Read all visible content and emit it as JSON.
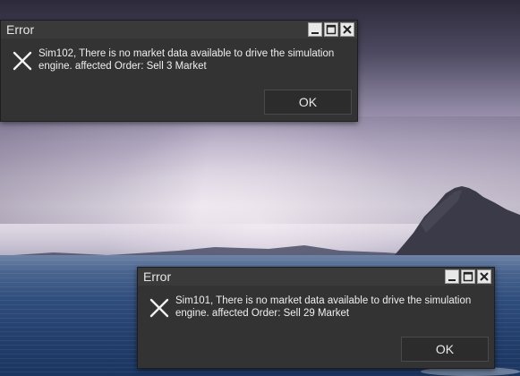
{
  "colors": {
    "dialog_bg": "#333333",
    "titlebar_bg": "#3a3a3a",
    "text": "#efefef",
    "button_bg": "#2c2c2c"
  },
  "dialogs": [
    {
      "title": "Error",
      "icon": "close-x-icon",
      "message": "Sim102, There is no market data available to drive the simulation engine. affected Order: Sell 3 Market",
      "ok_label": "OK",
      "window_buttons": [
        "minimize-icon",
        "maximize-icon",
        "close-icon"
      ]
    },
    {
      "title": "Error",
      "icon": "close-x-icon",
      "message": "Sim101, There is no market data available to drive the simulation engine. affected Order: Sell 29 Market",
      "ok_label": "OK",
      "window_buttons": [
        "minimize-icon",
        "maximize-icon",
        "close-icon"
      ]
    }
  ]
}
